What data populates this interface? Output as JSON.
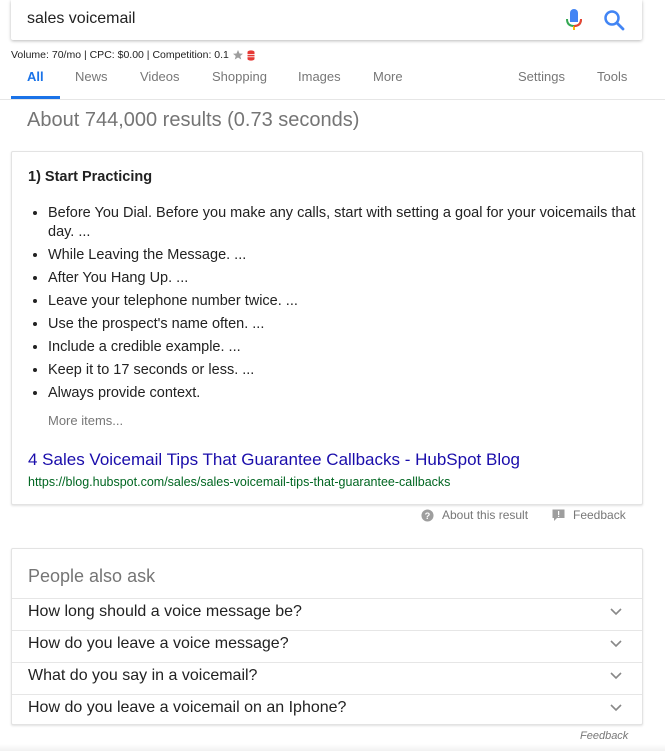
{
  "search": {
    "query": "sales voicemail"
  },
  "keyword_stats": {
    "text": "Volume: 70/mo | CPC: $0.00 | Competition: 0.1"
  },
  "tabs": [
    {
      "label": "All"
    },
    {
      "label": "News"
    },
    {
      "label": "Videos"
    },
    {
      "label": "Shopping"
    },
    {
      "label": "Images"
    },
    {
      "label": "More"
    },
    {
      "label": "Settings"
    },
    {
      "label": "Tools"
    }
  ],
  "result_stats": "About 744,000 results (0.73 seconds)",
  "snippet": {
    "heading": "1) Start Practicing",
    "items": [
      "Before You Dial. Before you make any calls, start with setting a goal for your voicemails that day. ...",
      "While Leaving the Message. ...",
      "After You Hang Up. ...",
      "Leave your telephone number twice. ...",
      "Use the prospect's name often. ...",
      "Include a credible example. ...",
      "Keep it to 17 seconds or less. ...",
      "Always provide context."
    ],
    "more_items": "More items...",
    "link_title": "4 Sales Voicemail Tips That Guarantee Callbacks - HubSpot Blog",
    "url": "https://blog.hubspot.com/sales/sales-voicemail-tips-that-guarantee-callbacks"
  },
  "about_result": "About this result",
  "feedback_label": "Feedback",
  "people_also_ask": {
    "title": "People also ask",
    "questions": [
      "How long should a voice message be?",
      "How do you leave a voice message?",
      "What do you say in a voicemail?",
      "How do you leave a voicemail on an Iphone?"
    ]
  },
  "bottom_feedback": "Feedback",
  "colors": {
    "accent": "#1a73e8",
    "link": "#1a0dab",
    "url": "#006621"
  }
}
